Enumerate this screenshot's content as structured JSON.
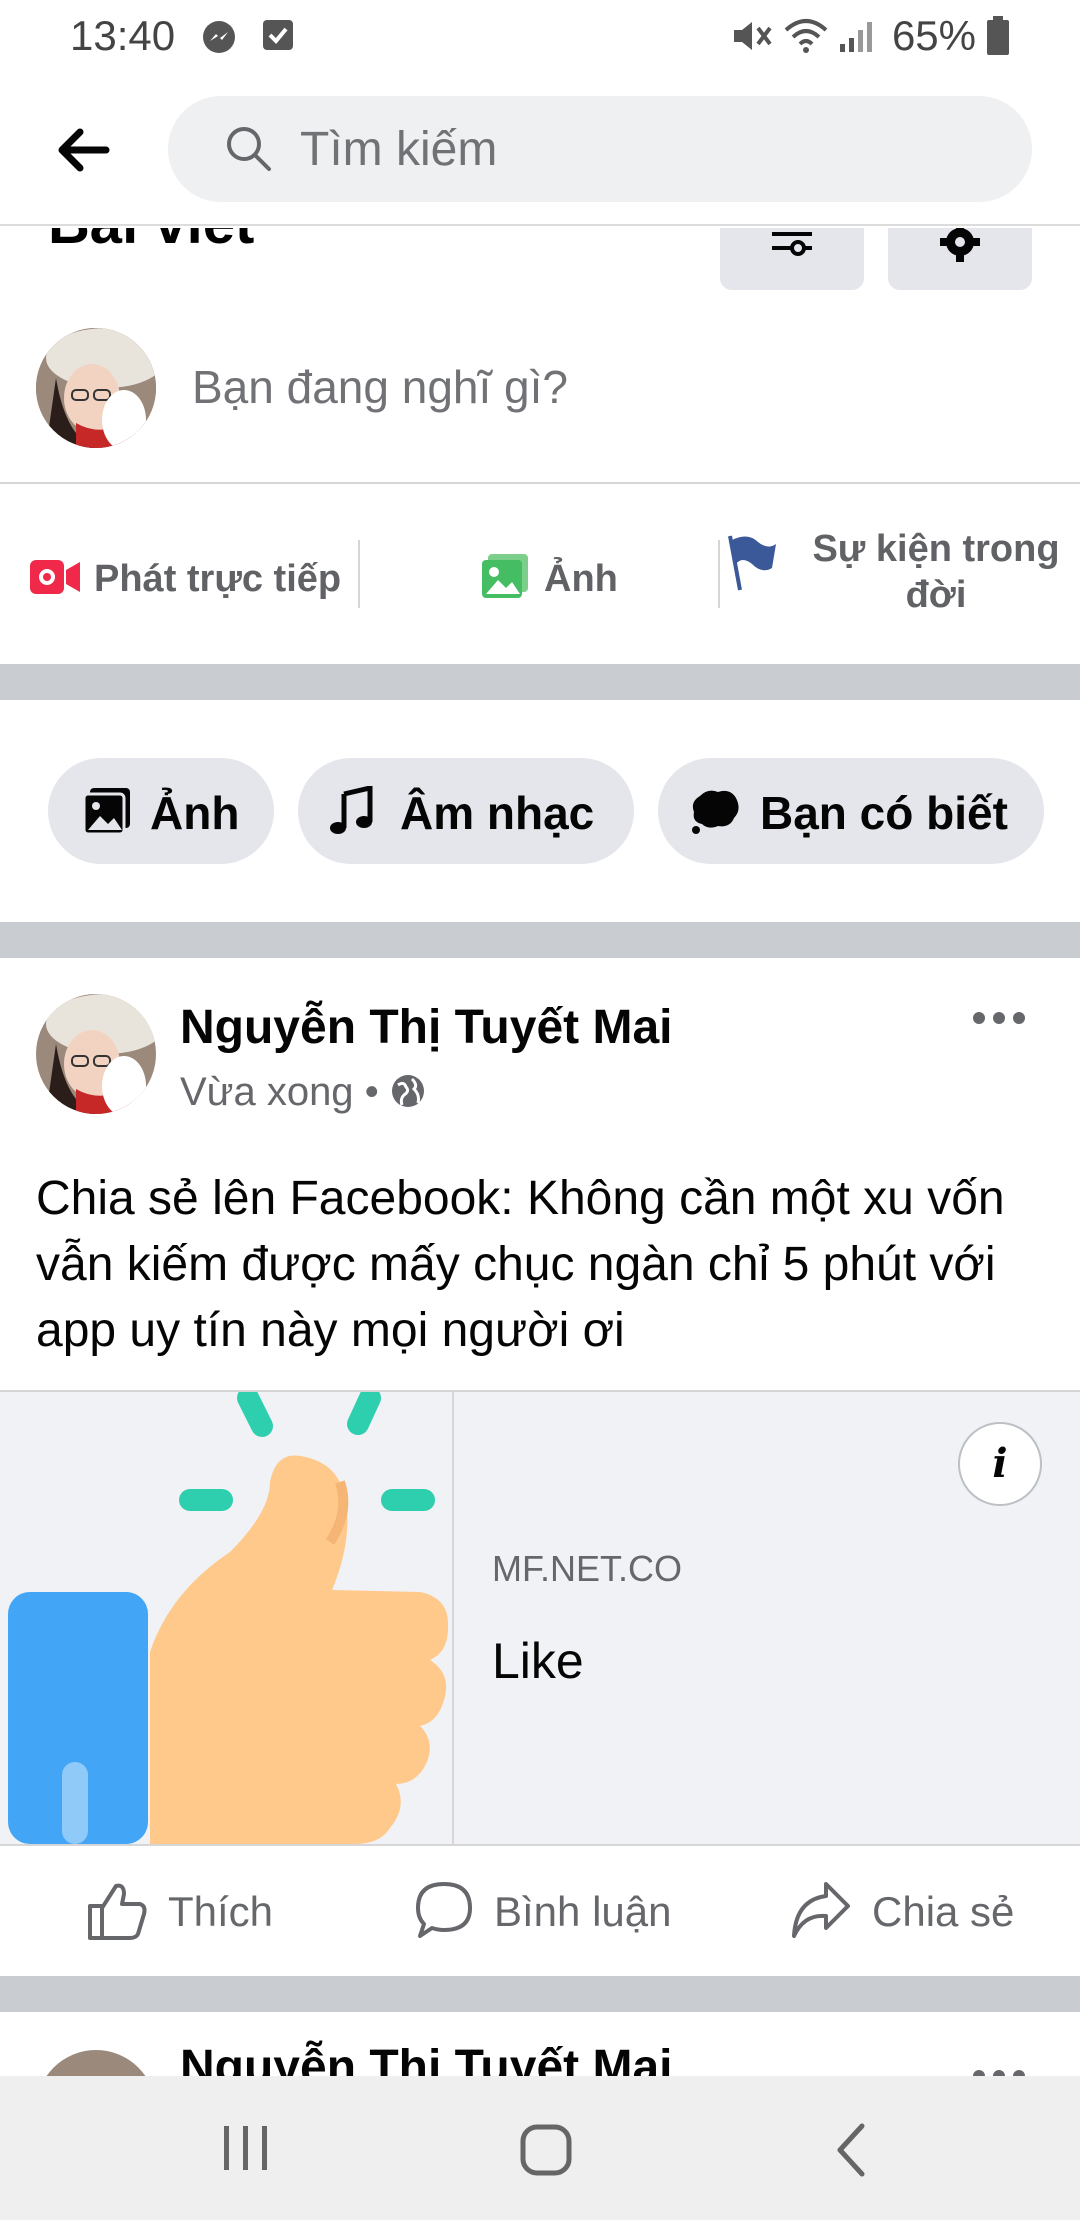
{
  "status_bar": {
    "time": "13:40",
    "battery": "65%",
    "icons": [
      "messenger-icon",
      "check-box-icon",
      "mute-icon",
      "wifi-icon",
      "signal-icon",
      "battery-icon"
    ]
  },
  "header": {
    "back_icon": "back-arrow-icon",
    "search_placeholder": "Tìm kiếm",
    "search_icon": "search-icon"
  },
  "section": {
    "title": "Bài viết",
    "filter_icon": "filter-icon",
    "settings_icon": "gear-icon"
  },
  "composer": {
    "prompt": "Bạn đang nghĩ gì?"
  },
  "actions": {
    "live": "Phát trực tiếp",
    "photo": "Ảnh",
    "life_event": "Sự kiện trong đời"
  },
  "chips": [
    {
      "label": "Ảnh",
      "icon": "photo-icon"
    },
    {
      "label": "Âm nhạc",
      "icon": "music-icon"
    },
    {
      "label": "Bạn có biết",
      "icon": "speech-bubble-icon"
    }
  ],
  "post": {
    "author": "Nguyễn Thị Tuyết Mai",
    "time": "Vừa xong",
    "privacy_icon": "globe-icon",
    "text": "Chia sẻ lên Facebook: Không cần một xu vốn vẫn kiếm được mấy chục ngàn chỉ 5 phút với app uy tín này mọi người ơi",
    "link": {
      "domain": "MF.NET.CO",
      "title": "Like",
      "image_icon": "thumbs-up-icon"
    },
    "reactions": {
      "like": "Thích",
      "comment": "Bình luận",
      "share": "Chia sẻ"
    }
  },
  "next_post": {
    "author": "Nguyễn Thị Tuyết Mai"
  },
  "colors": {
    "live_red": "#f02849",
    "photo_green": "#45bd62",
    "flag_blue": "#3b5998",
    "thumb_blue": "#42a5f5",
    "thumb_skin": "#ffc98b",
    "sparkle_teal": "#2ecfae"
  }
}
